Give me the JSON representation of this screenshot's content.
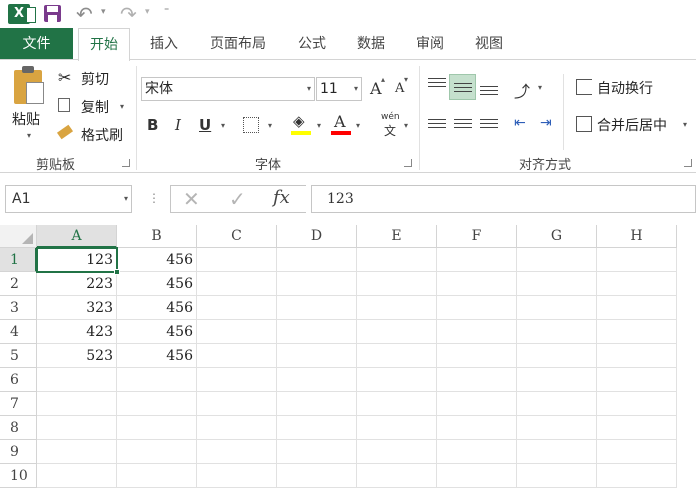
{
  "qat": {
    "app_icon": "excel-icon",
    "save_icon": "save-icon",
    "undo_icon": "undo-icon",
    "redo_icon": "redo-icon",
    "undo_glyph": "↶",
    "redo_glyph": "↷",
    "dropdown_glyph": "▾",
    "customize_glyph": "⁼"
  },
  "tabs": [
    {
      "label": "文件"
    },
    {
      "label": "开始"
    },
    {
      "label": "插入"
    },
    {
      "label": "页面布局"
    },
    {
      "label": "公式"
    },
    {
      "label": "数据"
    },
    {
      "label": "审阅"
    },
    {
      "label": "视图"
    }
  ],
  "ribbon": {
    "clipboard": {
      "label": "剪贴板",
      "paste": "粘贴",
      "cut": "剪切",
      "copy": "复制",
      "format_painter": "格式刷"
    },
    "font": {
      "label": "字体",
      "font_name": "宋体",
      "font_size": "11",
      "bold": "B",
      "italic": "I",
      "underline": "U",
      "grow": "A",
      "shrink": "A",
      "font_color_glyph": "A",
      "phonetic": "wén",
      "phonetic_char": "文",
      "highlight_color": "#ffff00",
      "font_color": "#ff0000"
    },
    "alignment": {
      "label": "对齐方式",
      "wrap_text": "自动换行",
      "merge_center": "合并后居中"
    }
  },
  "formula_bar": {
    "name_box": "A1",
    "cancel_glyph": "✕",
    "enter_glyph": "✓",
    "fx": "fx",
    "value": "123"
  },
  "sheet": {
    "columns": [
      "A",
      "B",
      "C",
      "D",
      "E",
      "F",
      "G",
      "H"
    ],
    "rows": [
      "1",
      "2",
      "3",
      "4",
      "5",
      "6",
      "7",
      "8",
      "9",
      "10"
    ],
    "cells": [
      [
        "123",
        "456"
      ],
      [
        "223",
        "456"
      ],
      [
        "323",
        "456"
      ],
      [
        "423",
        "456"
      ],
      [
        "523",
        "456"
      ]
    ],
    "active_cell": "A1",
    "accent": "#217346"
  }
}
